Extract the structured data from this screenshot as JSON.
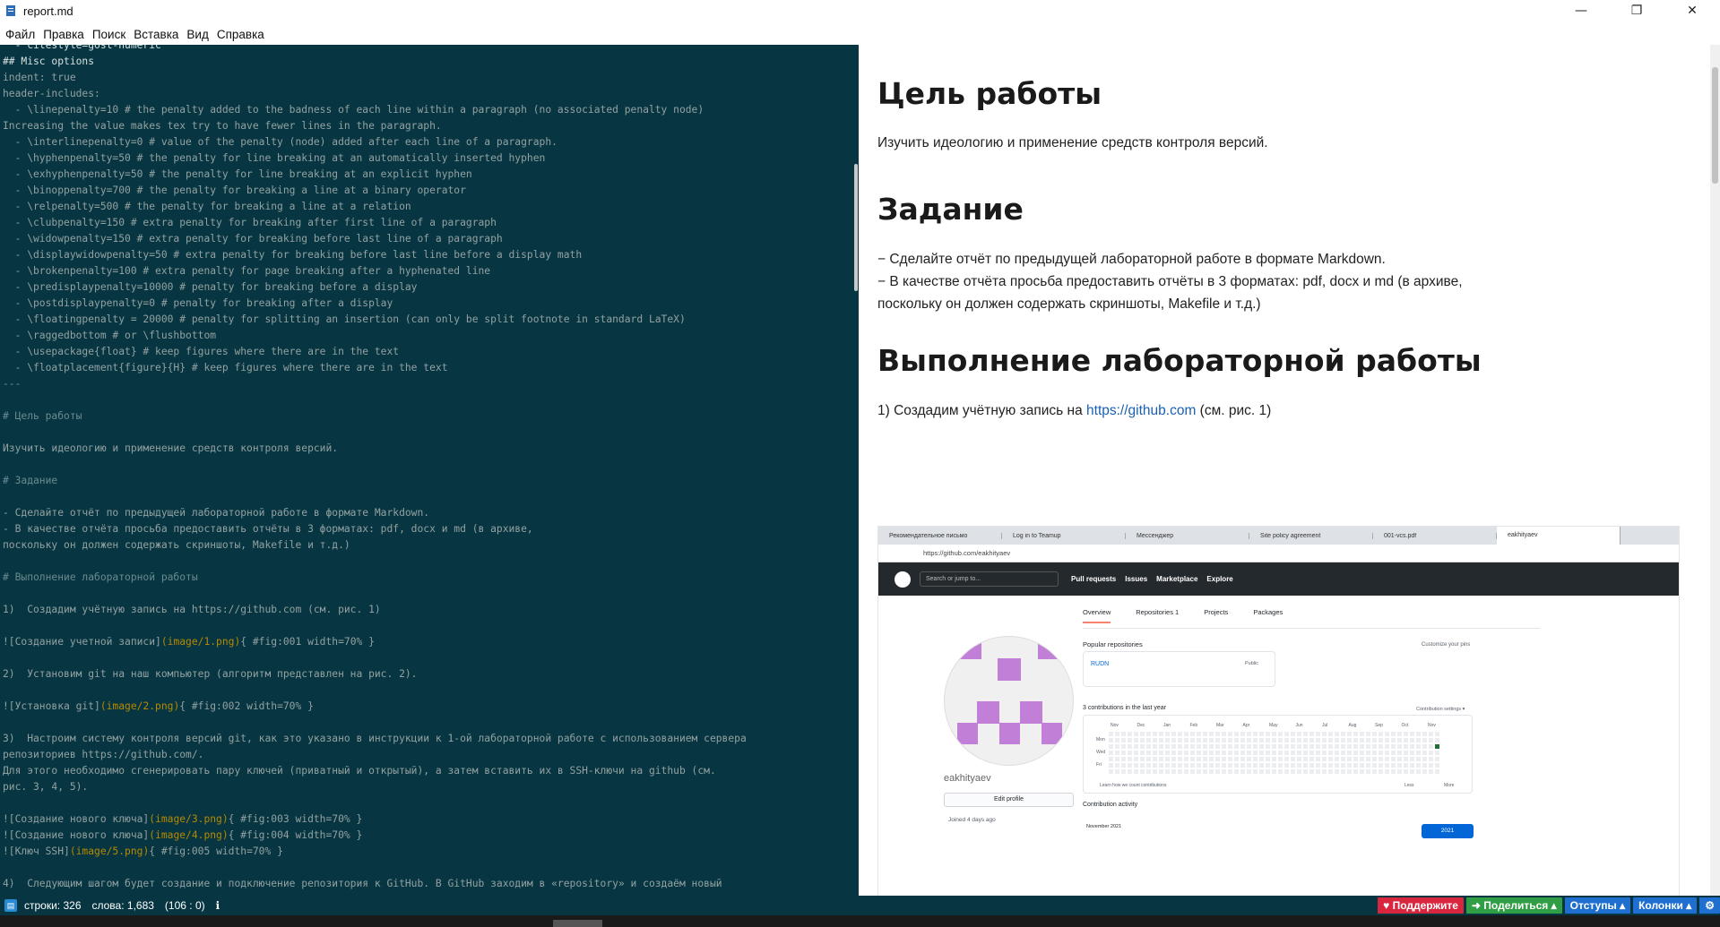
{
  "window": {
    "title": "report.md",
    "controls": [
      "—",
      "❐",
      "✕"
    ]
  },
  "menu": [
    "Файл",
    "Правка",
    "Поиск",
    "Вставка",
    "Вид",
    "Справка"
  ],
  "editor": {
    "lines": [
      {
        "t": "  - citestyle=gost-numeric",
        "k": "hl"
      },
      {
        "t": "## Misc options",
        "k": "hl"
      },
      {
        "t": "indent: true",
        "k": ""
      },
      {
        "t": "header-includes:",
        "k": ""
      },
      {
        "t": "  - \\linepenalty=10 # the penalty added to the badness of each line within a paragraph (no associated penalty node)",
        "k": ""
      },
      {
        "t": "Increasing the value makes tex try to have fewer lines in the paragraph.",
        "k": ""
      },
      {
        "t": "  - \\interlinepenalty=0 # value of the penalty (node) added after each line of a paragraph.",
        "k": ""
      },
      {
        "t": "  - \\hyphenpenalty=50 # the penalty for line breaking at an automatically inserted hyphen",
        "k": ""
      },
      {
        "t": "  - \\exhyphenpenalty=50 # the penalty for line breaking at an explicit hyphen",
        "k": ""
      },
      {
        "t": "  - \\binoppenalty=700 # the penalty for breaking a line at a binary operator",
        "k": ""
      },
      {
        "t": "  - \\relpenalty=500 # the penalty for breaking a line at a relation",
        "k": ""
      },
      {
        "t": "  - \\clubpenalty=150 # extra penalty for breaking after first line of a paragraph",
        "k": ""
      },
      {
        "t": "  - \\widowpenalty=150 # extra penalty for breaking before last line of a paragraph",
        "k": ""
      },
      {
        "t": "  - \\displaywidowpenalty=50 # extra penalty for breaking before last line before a display math",
        "k": ""
      },
      {
        "t": "  - \\brokenpenalty=100 # extra penalty for page breaking after a hyphenated line",
        "k": ""
      },
      {
        "t": "  - \\predisplaypenalty=10000 # penalty for breaking before a display",
        "k": ""
      },
      {
        "t": "  - \\postdisplaypenalty=0 # penalty for breaking after a display",
        "k": ""
      },
      {
        "t": "  - \\floatingpenalty = 20000 # penalty for splitting an insertion (can only be split footnote in standard LaTeX)",
        "k": ""
      },
      {
        "t": "  - \\raggedbottom # or \\flushbottom",
        "k": ""
      },
      {
        "t": "  - \\usepackage{float} # keep figures where there are in the text",
        "k": ""
      },
      {
        "t": "  - \\floatplacement{figure}{H} # keep figures where there are in the text",
        "k": ""
      },
      {
        "t": "---",
        "k": "c"
      },
      {
        "t": "",
        "k": ""
      },
      {
        "t": "# Цель работы",
        "k": "c"
      },
      {
        "t": "",
        "k": ""
      },
      {
        "t": "Изучить идеологию и применение средств контроля версий.",
        "k": ""
      },
      {
        "t": "",
        "k": ""
      },
      {
        "t": "# Задание",
        "k": "c"
      },
      {
        "t": "",
        "k": ""
      },
      {
        "t": "- Сделайте отчёт по предыдущей лабораторной работе в формате Markdown.",
        "k": ""
      },
      {
        "t": "- В качестве отчёта просьба предоставить отчёты в 3 форматах: pdf, docx и md (в архиве,",
        "k": ""
      },
      {
        "t": "поскольку он должен содержать скриншоты, Makefile и т.д.)",
        "k": ""
      },
      {
        "t": "",
        "k": ""
      },
      {
        "t": "# Выполнение лабораторной работы",
        "k": "c"
      },
      {
        "t": "",
        "k": ""
      },
      {
        "t": "1)  Создадим учётную запись на https://github.com (см. рис. 1)",
        "k": ""
      },
      {
        "t": "",
        "k": ""
      },
      {
        "t": "![Создание учетной записи](image/1.png){ #fig:001 width=70% }",
        "k": "img"
      },
      {
        "t": "",
        "k": ""
      },
      {
        "t": "2)  Установим git на наш компьютер (алгоритм представлен на рис. 2).",
        "k": ""
      },
      {
        "t": "",
        "k": ""
      },
      {
        "t": "![Установка git](image/2.png){ #fig:002 width=70% }",
        "k": "img"
      },
      {
        "t": "",
        "k": ""
      },
      {
        "t": "3)  Настроим систему контроля версий git, как это указано в инструкции к 1-ой лабораторной работе с использованием сервера",
        "k": ""
      },
      {
        "t": "репозиториев https://github.com/.",
        "k": ""
      },
      {
        "t": "Для этого необходимо сгенерировать пару ключей (приватный и открытый), а затем вставить их в SSH-ключи на github (см.",
        "k": ""
      },
      {
        "t": "рис. 3, 4, 5).",
        "k": ""
      },
      {
        "t": "",
        "k": ""
      },
      {
        "t": "![Создание нового ключа](image/3.png){ #fig:003 width=70% }",
        "k": "img"
      },
      {
        "t": "![Создание нового ключа](image/4.png){ #fig:004 width=70% }",
        "k": "img"
      },
      {
        "t": "![Ключ SSH](image/5.png){ #fig:005 width=70% }",
        "k": "img"
      },
      {
        "t": "",
        "k": ""
      },
      {
        "t": "4)  Следующим шагом будет создание и подключение репозитория к GitHub. В GitHub заходим в «repository» и создаём новый",
        "k": ""
      }
    ]
  },
  "preview": {
    "h_goal": "Цель работы",
    "p_goal": "Изучить идеологию и применение средств контроля версий.",
    "h_task": "Задание",
    "task_line1": "− Сделайте отчёт по предыдущей лабораторной работе в формате Markdown.",
    "task_line2": "− В качестве отчёта просьба предоставить отчёты в 3 форматах: pdf, docx и md (в архиве,",
    "task_line3": "поскольку он должен содержать скриншоты, Makefile и т.д.)",
    "h_exec": "Выполнение лабораторной работы",
    "step1_pre": "1) Создадим учётную запись на ",
    "step1_link": "https://github.com",
    "step1_post": " (см. рис. 1)"
  },
  "screenshot": {
    "tabs": [
      "Рекомендательное письмо",
      "Log in to Teamup",
      "Мессенджер",
      "Site policy agreement",
      "001-vcs.pdf",
      "eakhityaev"
    ],
    "url": "https://github.com/eakhityaev",
    "search_placeholder": "Search or jump to...",
    "nav": [
      "Pull requests",
      "Issues",
      "Marketplace",
      "Explore"
    ],
    "profile_tabs": [
      "Overview",
      "Repositories 1",
      "Projects",
      "Packages"
    ],
    "popular": "Popular repositories",
    "customize": "Customize your pins",
    "repo_name": "RUDN",
    "repo_badge": "Public",
    "contributions": "3 contributions in the last year",
    "contrib_settings": "Contribution settings ▾",
    "months": [
      "Nov",
      "Dec",
      "Jan",
      "Feb",
      "Mar",
      "Apr",
      "May",
      "Jun",
      "Jul",
      "Aug",
      "Sep",
      "Oct",
      "Nov"
    ],
    "days": [
      "Mon",
      "Wed",
      "Fri"
    ],
    "learn": "Learn how we count contributions",
    "less": "Less",
    "more": "More",
    "username": "eakhityaev",
    "edit_profile": "Edit profile",
    "joined": "Joined 4 days ago",
    "activity": "Contribution activity",
    "year": "2021",
    "month_label": "November 2021"
  },
  "status": {
    "lines": "строки: 326",
    "words": "слова: 1,683",
    "pos": "(106 : 0)",
    "support": "♥ Поддержите",
    "share": "➜ Поделиться ▴",
    "indents": "Отступы ▴",
    "columns": "Колонки ▴",
    "settings_icon": "⚙"
  },
  "colors": {
    "editor_bg": "#073642",
    "support_btn": "#d7263d",
    "share_btn": "#2f9e44",
    "indent_btn": "#1f6fd1",
    "columns_btn": "#1f6fd1",
    "settings_btn": "#1f6fd1"
  }
}
